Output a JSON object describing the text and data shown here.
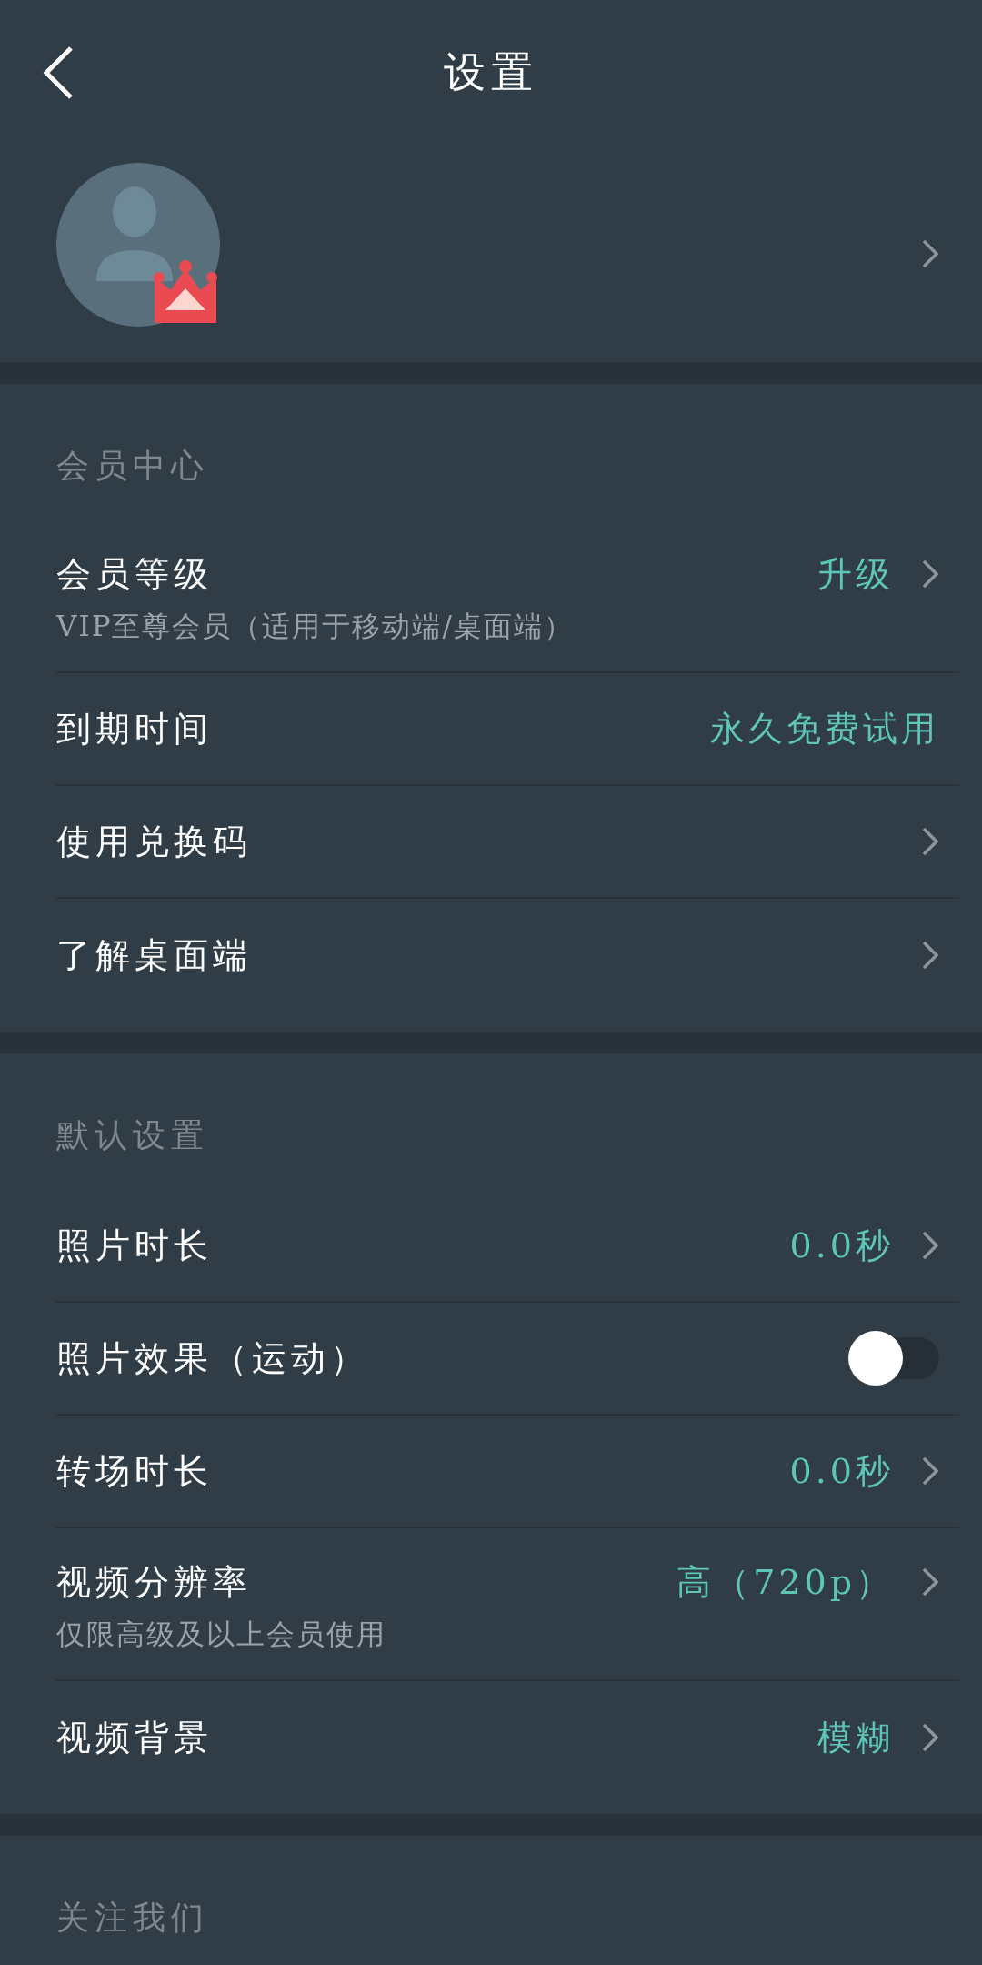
{
  "header": {
    "title": "设置"
  },
  "sections": [
    {
      "title": "会员中心",
      "rows": [
        {
          "kind": "nav",
          "label": "会员等级",
          "sub": "VIP至尊会员（适用于移动端/桌面端）",
          "value": "升级"
        },
        {
          "kind": "info",
          "label": "到期时间",
          "value": "永久免费试用"
        },
        {
          "kind": "nav",
          "label": "使用兑换码"
        },
        {
          "kind": "nav",
          "label": "了解桌面端"
        }
      ]
    },
    {
      "title": "默认设置",
      "rows": [
        {
          "kind": "nav",
          "label": "照片时长",
          "value": "0.0秒"
        },
        {
          "kind": "switch",
          "label": "照片效果（运动）",
          "on": false
        },
        {
          "kind": "nav",
          "label": "转场时长",
          "value": "0.0秒"
        },
        {
          "kind": "nav",
          "label": "视频分辨率",
          "sub": "仅限高级及以上会员使用",
          "value": "高（720p）"
        },
        {
          "kind": "nav",
          "label": "视频背景",
          "value": "模糊"
        }
      ]
    },
    {
      "title": "关注我们"
    }
  ]
}
